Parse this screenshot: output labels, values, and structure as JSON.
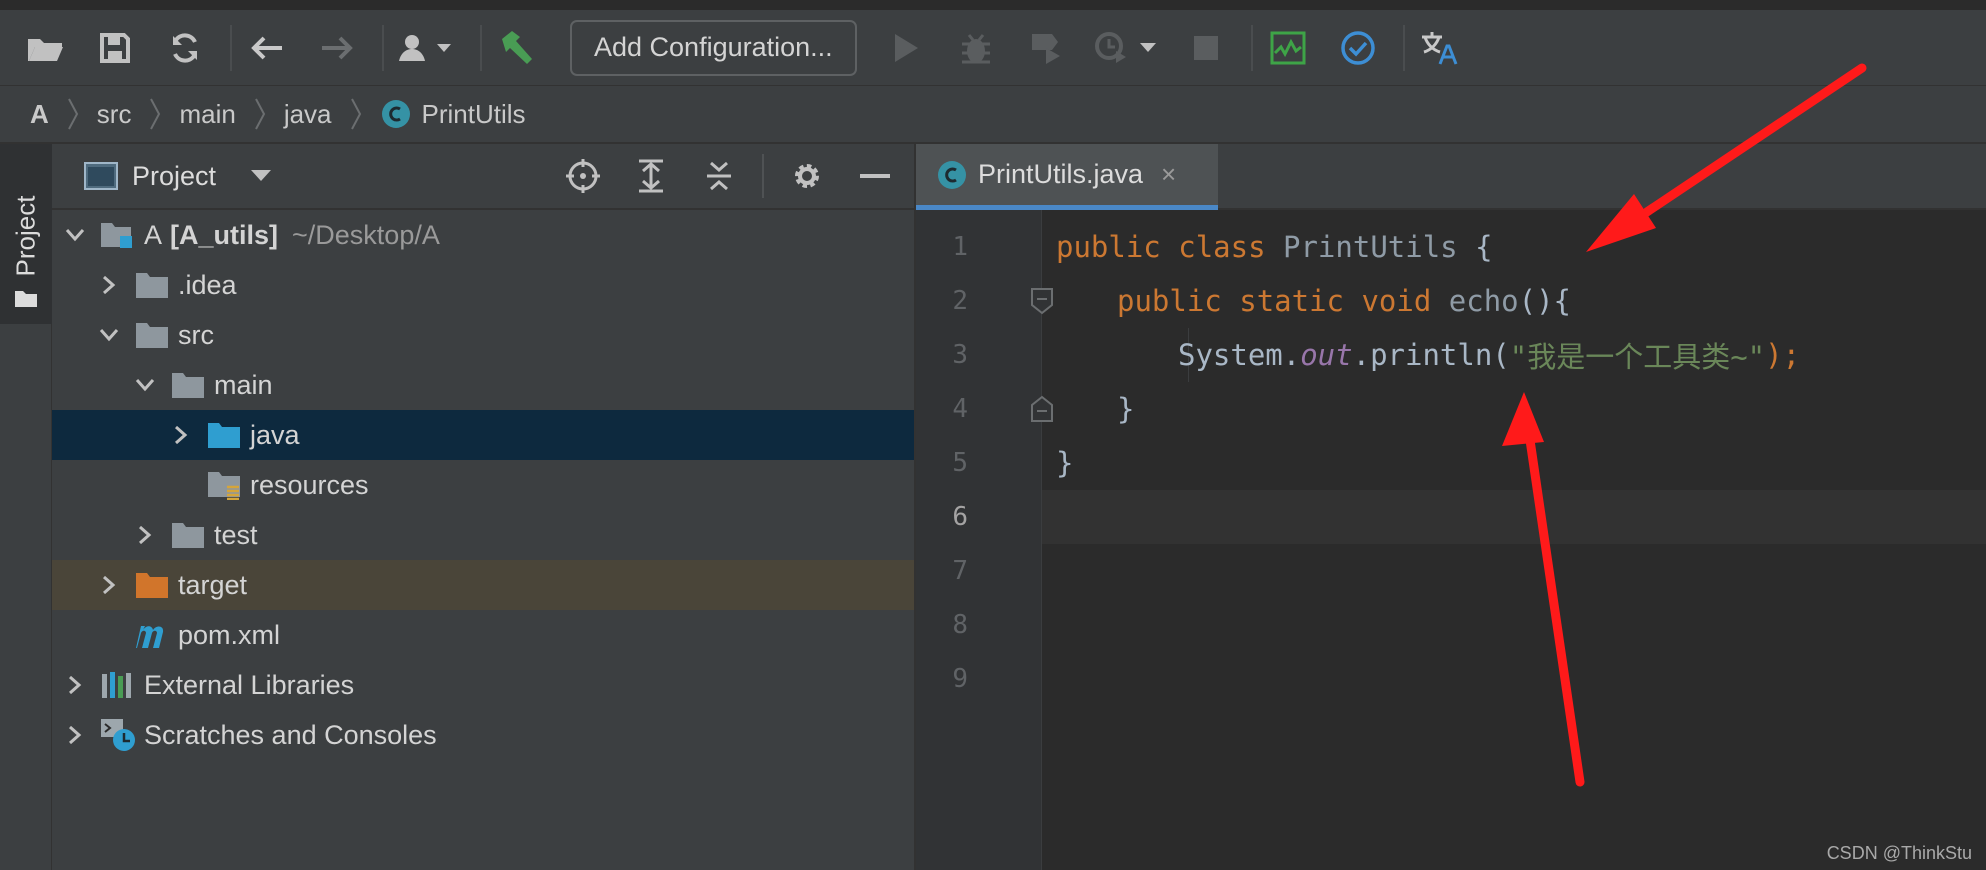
{
  "toolbar": {
    "config_label": "Add Configuration..."
  },
  "breadcrumb": [
    "A",
    "src",
    "main",
    "java",
    "PrintUtils"
  ],
  "side_strip": {
    "label": "Project"
  },
  "project_panel": {
    "title": "Project",
    "tree": {
      "root_name": "A",
      "root_module": "[A_utils]",
      "root_path": "~/Desktop/A",
      "idea": ".idea",
      "src": "src",
      "main": "main",
      "java": "java",
      "resources": "resources",
      "test": "test",
      "target": "target",
      "pom": "pom.xml",
      "ext_libs": "External Libraries",
      "scratches": "Scratches and Consoles"
    }
  },
  "editor": {
    "tab_label": "PrintUtils.java",
    "tab_close": "×",
    "line_numbers": [
      "1",
      "2",
      "3",
      "4",
      "5",
      "6",
      "7",
      "8",
      "9"
    ],
    "code": {
      "l1_kw1": "public",
      "l1_kw2": "class",
      "l1_name": "PrintUtils",
      "l1_brace": "{",
      "l2_kw1": "public",
      "l2_kw2": "static",
      "l2_kw3": "void",
      "l2_name": "echo",
      "l2_rest": "(){",
      "l3_sys": "System.",
      "l3_out": "out",
      "l3_call": ".println(",
      "l3_str": "\"我是一个工具类~\"",
      "l3_end": ");",
      "l4": "}",
      "l5": "}"
    }
  },
  "watermark": "CSDN @ThinkStu",
  "colors": {
    "keyword": "#cc7832",
    "string": "#6a8759",
    "static_field": "#9876aa",
    "arrow": "#ff1a1a",
    "selection": "#0d293e"
  }
}
